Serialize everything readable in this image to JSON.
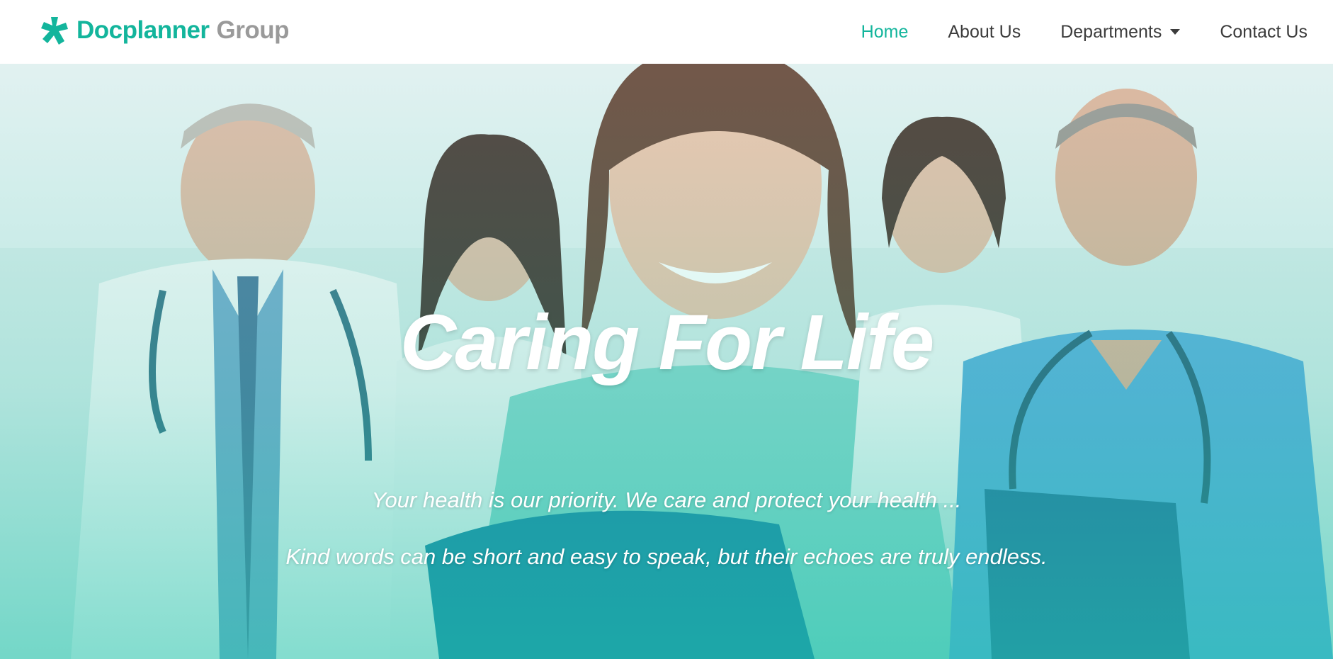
{
  "brand": {
    "name": "Docplanner",
    "sub": "Group",
    "logo_icon": "docplanner-star-logo",
    "accent_color": "#13b59c"
  },
  "nav": {
    "items": [
      {
        "label": "Home",
        "active": true
      },
      {
        "label": "About Us"
      },
      {
        "label": "Departments",
        "dropdown": true
      },
      {
        "label": "Contact Us"
      }
    ]
  },
  "hero": {
    "title": "Caring For Life",
    "line1": "Your health is our priority. We care and protect your health ...",
    "line2": "Kind words can be short and easy to speak, but their echoes are truly endless.",
    "image": "medical-team-photo"
  }
}
